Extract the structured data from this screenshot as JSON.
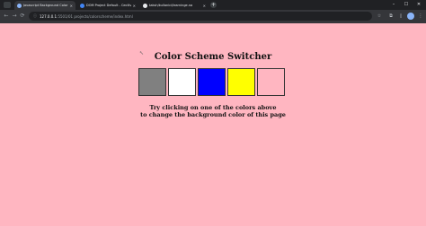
{
  "browser": {
    "tabs": [
      {
        "title": "Javascript Background Color Cha",
        "active": true,
        "favicon_color": "#8ab4f8"
      },
      {
        "title": "DOM Project Default - Ceciliv",
        "active": false,
        "favicon_color": "#4285f4"
      },
      {
        "title": "taksh/kullanici/learninge.na",
        "active": false,
        "favicon_color": "#e8eaed"
      }
    ],
    "new_tab_label": "+",
    "window_controls": [
      "–",
      "☐",
      "✕"
    ],
    "address": {
      "host": "127.0.0.1",
      "rest": ":5501/01 projects/colorscheme/index.html"
    },
    "nav": {
      "back": "←",
      "forward": "→",
      "reload": "⟳"
    }
  },
  "page": {
    "title": "Color Scheme Switcher",
    "background": "#ffb6c1",
    "swatches": [
      {
        "name": "grey",
        "color": "#808080"
      },
      {
        "name": "white",
        "color": "#ffffff"
      },
      {
        "name": "blue",
        "color": "#0000ff"
      },
      {
        "name": "yellow",
        "color": "#ffff00"
      },
      {
        "name": "pink",
        "color": "#ffb6c1"
      }
    ],
    "hint_line1": "Try clicking on one of the colors above",
    "hint_line2": "to change the background color of this page"
  }
}
